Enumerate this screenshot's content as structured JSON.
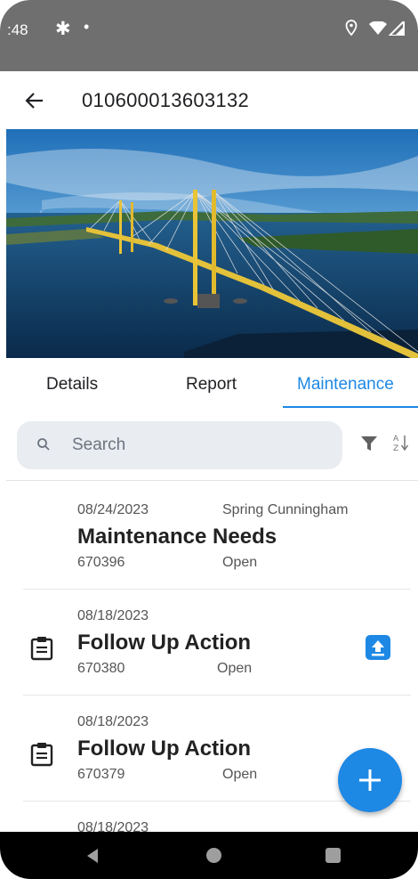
{
  "status_bar": {
    "time": ":48",
    "gear_icon": "gear-icon",
    "dot": "•",
    "location_icon": "location-icon",
    "wifi_icon": "wifi-icon",
    "signal_icon": "signal-icon"
  },
  "header": {
    "back_icon": "back-arrow-icon",
    "title": "010600013603132"
  },
  "tabs": [
    {
      "label": "Details",
      "active": false
    },
    {
      "label": "Report",
      "active": false
    },
    {
      "label": "Maintenance",
      "active": true
    }
  ],
  "search": {
    "placeholder": "Search",
    "search_icon": "search-icon",
    "filter_icon": "filter-icon",
    "sort_icon": "sort-az-icon"
  },
  "items": [
    {
      "date": "08/24/2023",
      "assignee": "Spring Cunningham",
      "title": "Maintenance Needs",
      "number": "670396",
      "status": "Open",
      "icon": "",
      "upload": false
    },
    {
      "date": "08/18/2023",
      "assignee": "",
      "title": "Follow Up Action",
      "number": "670380",
      "status": "Open",
      "icon": "clipboard-icon",
      "upload": true
    },
    {
      "date": "08/18/2023",
      "assignee": "",
      "title": "Follow Up Action",
      "number": "670379",
      "status": "Open",
      "icon": "clipboard-icon",
      "upload": false
    },
    {
      "date": "08/18/2023",
      "assignee": "",
      "title": "",
      "number": "",
      "status": "",
      "icon": "",
      "upload": false
    }
  ],
  "fab": {
    "icon": "plus-icon"
  },
  "nav": {
    "back_icon": "nav-back-icon",
    "home_icon": "nav-home-icon",
    "recents_icon": "nav-recents-icon"
  },
  "colors": {
    "accent": "#1e88e5",
    "status_bar": "#6f6f6f"
  }
}
